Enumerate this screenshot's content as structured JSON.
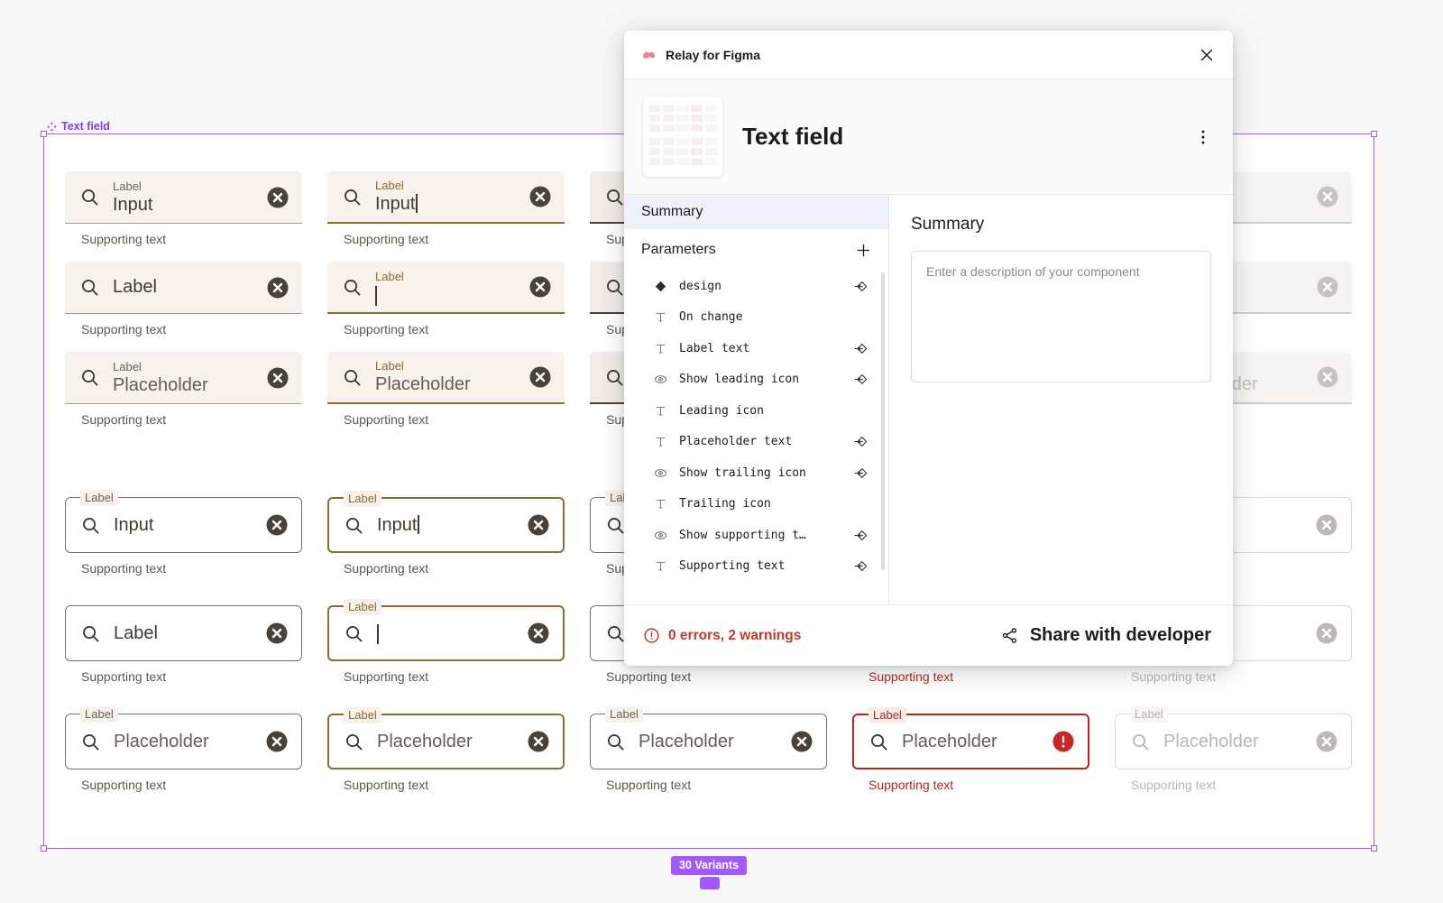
{
  "canvas": {
    "frame_label": "Text field",
    "variants_badge": "30 Variants",
    "label_text": "Label",
    "support_text": "Supporting text",
    "values": {
      "input": "Input",
      "label": "Label",
      "placeholder": "Placeholder"
    },
    "accent_purple": "#a259ff",
    "error_red": "#b3261e",
    "focus_gold": "#8a6d2f",
    "filled_bg": "#f8f1ec",
    "rows_filled": [
      {
        "state": "enabled",
        "variant": "input",
        "label_floating": true,
        "value": "Input"
      },
      {
        "state": "enabled",
        "variant": "label-only",
        "label_floating": false,
        "value": "Label"
      },
      {
        "state": "enabled",
        "variant": "placeholder",
        "label_floating": true,
        "value": "Placeholder"
      }
    ],
    "rows_outlined": [
      {
        "state": "enabled",
        "variant": "input",
        "label_floating": true,
        "value": "Input"
      },
      {
        "state": "enabled",
        "variant": "label-only",
        "label_floating": false,
        "value": "Label"
      },
      {
        "state": "enabled",
        "variant": "placeholder",
        "label_floating": true,
        "value": "Placeholder"
      }
    ],
    "columns": [
      "enabled",
      "focused",
      "hovered",
      "error",
      "disabled"
    ]
  },
  "dialog": {
    "title": "Relay for Figma",
    "close_label": "Close",
    "component_name": "Text field",
    "more_label": "More options",
    "nav": {
      "summary": "Summary"
    },
    "parameters": {
      "header": "Parameters",
      "add_label": "Add parameter",
      "items": [
        {
          "type": "diamond",
          "name": "design",
          "bound": true
        },
        {
          "type": "text",
          "name": "On change",
          "bound": false
        },
        {
          "type": "text",
          "name": "Label text",
          "bound": true
        },
        {
          "type": "eye",
          "name": "Show leading icon",
          "bound": true
        },
        {
          "type": "text",
          "name": "Leading icon",
          "bound": false
        },
        {
          "type": "text",
          "name": "Placeholder text",
          "bound": true
        },
        {
          "type": "eye",
          "name": "Show trailing icon",
          "bound": true
        },
        {
          "type": "text",
          "name": "Trailing icon",
          "bound": false
        },
        {
          "type": "eye",
          "name": "Show supporting t…",
          "bound": true
        },
        {
          "type": "text",
          "name": "Supporting text",
          "bound": true
        }
      ]
    },
    "right": {
      "title": "Summary",
      "description_value": "",
      "description_placeholder": "Enter a description of your component"
    },
    "footer": {
      "warnings_text": "0 errors, 2 warnings",
      "warnings_color": "#c0392b",
      "share_label": "Share with developer"
    }
  }
}
